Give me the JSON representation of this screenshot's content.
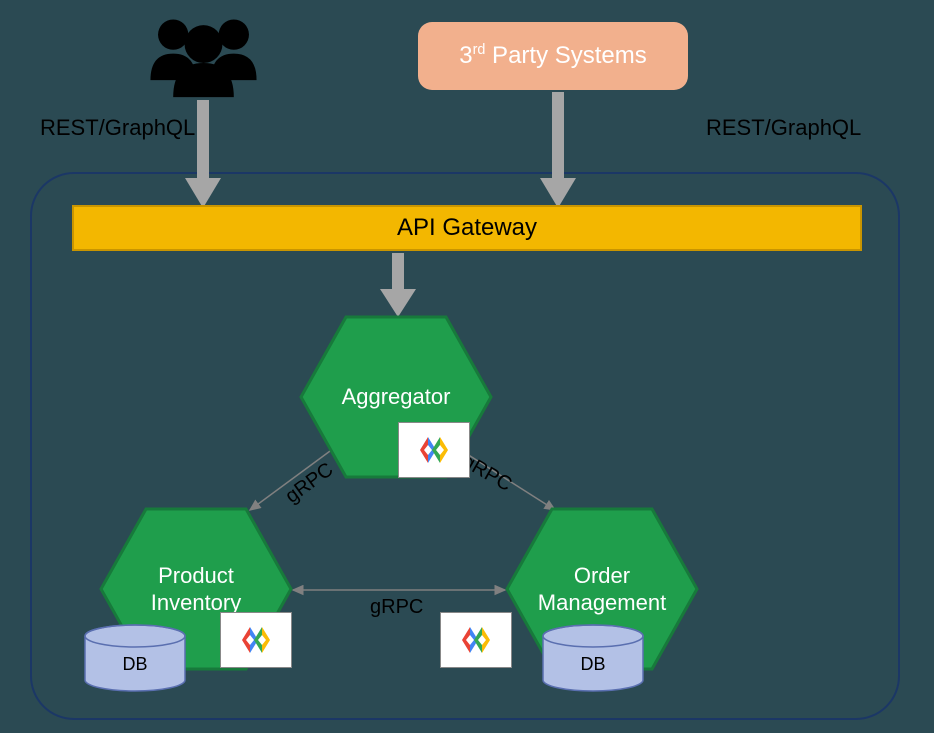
{
  "external": {
    "users_protocol_label": "REST/GraphQL",
    "third_party_label_html": "3<sup>rd</sup> Party Systems",
    "third_party_protocol_label": "REST/GraphQL"
  },
  "gateway": {
    "label": "API Gateway"
  },
  "services": {
    "aggregator": {
      "label": "Aggregator"
    },
    "product_inventory": {
      "label": "Product\nInventory",
      "db_label": "DB"
    },
    "order_management": {
      "label": "Order\nManagement",
      "db_label": "DB"
    }
  },
  "connections": {
    "agg_to_product": "gRPC",
    "agg_to_order": "gRPC",
    "product_to_order": "gRPC"
  },
  "colors": {
    "background": "#2b4a53",
    "hex_fill": "#1f9e4c",
    "hex_stroke": "#177a3b",
    "api_fill": "#f3b700",
    "third_party_fill": "#f2b08d",
    "arrow_gray": "#a6a6a6",
    "thin_arrow": "#808080",
    "db_fill": "#b3c1e6"
  }
}
